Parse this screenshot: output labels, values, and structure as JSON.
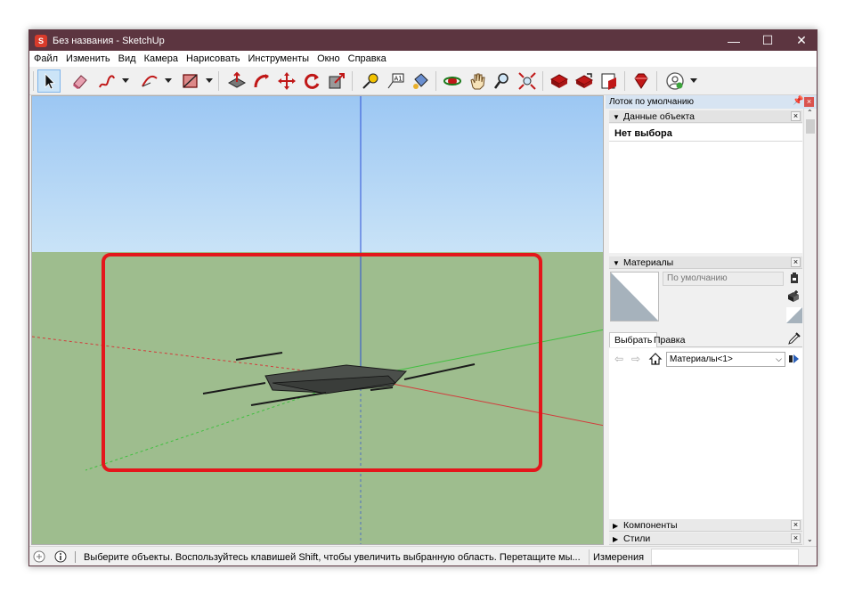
{
  "window": {
    "title": "Без названия - SketchUp",
    "app_icon": "sketchup-logo-icon",
    "controls": {
      "minimize": "—",
      "maximize": "☐",
      "close": "✕"
    },
    "accent": "#5c3540"
  },
  "menu": {
    "items": [
      "Файл",
      "Изменить",
      "Вид",
      "Камера",
      "Нарисовать",
      "Инструменты",
      "Окно",
      "Справка"
    ]
  },
  "toolbar": {
    "icons": [
      "select-tool-icon",
      "eraser-tool-icon",
      "freehand-tool-icon",
      "arc-tool-icon",
      "rectangle-tool-icon",
      "push-pull-tool-icon",
      "follow-me-tool-icon",
      "move-tool-icon",
      "rotate-tool-icon",
      "scale-tool-icon",
      "tape-measure-icon",
      "text-tool-icon",
      "paint-bucket-icon",
      "orbit-tool-icon",
      "pan-tool-icon",
      "zoom-tool-icon",
      "zoom-extents-icon",
      "warehouse-icon",
      "share-model-icon",
      "extension-warehouse-icon",
      "ruby-icon",
      "account-icon"
    ]
  },
  "tray": {
    "title": "Лоток по умолчанию",
    "entity_info": {
      "header": "Данные объекта",
      "selection": "Нет выбора"
    },
    "materials": {
      "header": "Материалы",
      "default_name": "По умолчанию",
      "tab_select": "Выбрать",
      "tab_edit": "Правка",
      "library": "Материалы<1>"
    },
    "components": {
      "header": "Компоненты"
    },
    "styles": {
      "header": "Стили"
    }
  },
  "status": {
    "message": "Выберите объекты. Воспользуйтесь клавишей Shift, чтобы увеличить выбранную область. Перетащите мы...",
    "measurements_label": "Измерения",
    "measurements_value": ""
  },
  "colors": {
    "sky": "#9cc7f3",
    "ground": "#9ebd8e",
    "highlight": "#e4161b",
    "axis_red": "#d23b3b",
    "axis_green": "#3fbf3f",
    "axis_blue": "#2b4fd6"
  }
}
